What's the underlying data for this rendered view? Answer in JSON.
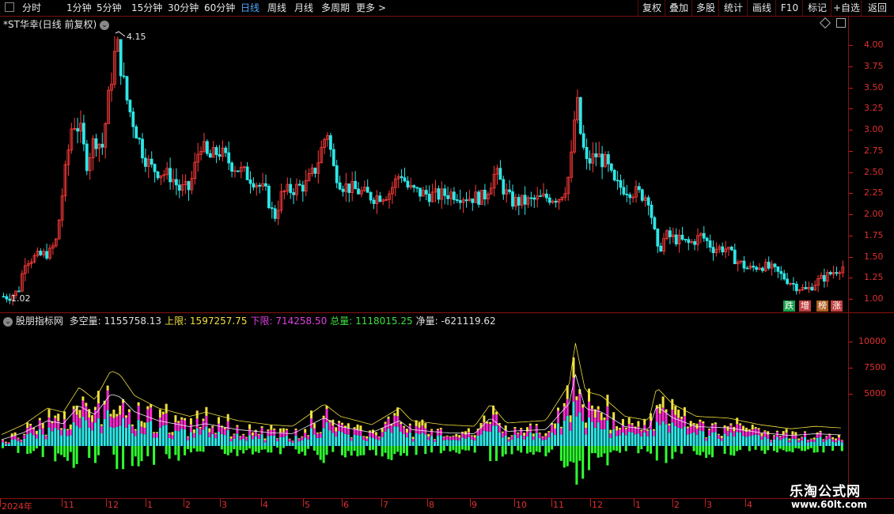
{
  "toolbar": {
    "periods": [
      "分时",
      "1分钟",
      "5分钟",
      "15分钟",
      "30分钟",
      "60分钟",
      "日线",
      "周线",
      "月线",
      "多周期",
      "更多 >"
    ],
    "active_period": "日线",
    "buttons": [
      "复权",
      "叠加",
      "多股",
      "统计",
      "画线",
      "F10",
      "标记",
      "+自选",
      "返回"
    ]
  },
  "main_chart": {
    "title": "*ST华幸(日线 前复权)",
    "high_label": "4.15",
    "low_label": "1.02",
    "y_ticks": [
      "4.00",
      "3.75",
      "3.50",
      "3.25",
      "3.00",
      "2.75",
      "2.50",
      "2.25",
      "2.00",
      "1.75",
      "1.50",
      "1.25",
      "1.00"
    ],
    "badges": [
      {
        "text": "跌",
        "color": "#ffffff",
        "bg": "#1aa04a"
      },
      {
        "text": "增",
        "color": "#ffffff",
        "bg": "#c04040"
      },
      {
        "text": "榜",
        "color": "#ffffff",
        "bg": "#b06020"
      },
      {
        "text": "涨",
        "color": "#ffffff",
        "bg": "#c04040"
      }
    ]
  },
  "indicator": {
    "name": "股朋指标网",
    "items": [
      {
        "label": "多空量: ",
        "value": "1155758.13",
        "color": "#e0e0e0"
      },
      {
        "label": "上限: ",
        "value": "1597257.75",
        "color": "#f0e040"
      },
      {
        "label": "下限: ",
        "value": "714258.50",
        "color": "#e040e0"
      },
      {
        "label": "总量: ",
        "value": "1118015.25",
        "color": "#40e040"
      },
      {
        "label": "净量: ",
        "value": "-621119.62",
        "color": "#e0e0e0"
      }
    ],
    "y_ticks": [
      "10000",
      "7500",
      "5000"
    ]
  },
  "date_axis": [
    "2024年",
    "11",
    "12",
    "1",
    "2",
    "3",
    "4",
    "5",
    "6",
    "7",
    "8",
    "9",
    "10",
    "11",
    "12",
    "1",
    "2",
    "3",
    "4"
  ],
  "watermark": {
    "title": "乐淘公式网",
    "url": "www.60lt.com"
  },
  "colors": {
    "up": "#ff3b3b",
    "down": "#2ee6e6",
    "border": "#8b1111",
    "yellow": "#f0e040",
    "magenta": "#ff2ad4",
    "green": "#30ff30"
  }
}
